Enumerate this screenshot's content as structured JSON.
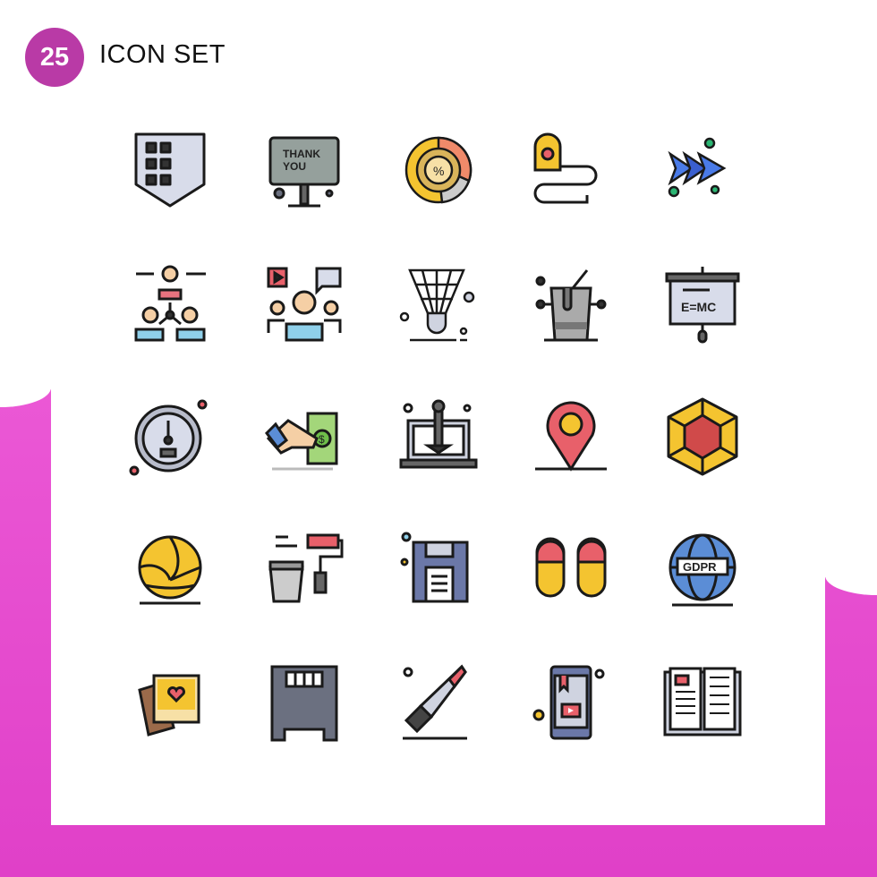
{
  "header": {
    "count": "25",
    "title": "ICON SET"
  },
  "colors": {
    "accent": "#b93aa6",
    "background_band": "#e94fd3",
    "stroke": "#1a1a1a"
  },
  "icons": [
    {
      "name": "shield-grid-icon"
    },
    {
      "name": "thank-you-billboard-icon",
      "text_line1": "THANK",
      "text_line2": "YOU"
    },
    {
      "name": "percent-donut-chart-icon",
      "text": "%"
    },
    {
      "name": "measuring-tape-icon"
    },
    {
      "name": "fast-forward-arrows-icon"
    },
    {
      "name": "team-hierarchy-icon"
    },
    {
      "name": "presenter-media-icon"
    },
    {
      "name": "shuttlecock-icon"
    },
    {
      "name": "ice-bucket-bottle-icon"
    },
    {
      "name": "emc-presentation-board-icon",
      "text": "E=MC"
    },
    {
      "name": "speedometer-gauge-icon"
    },
    {
      "name": "hand-payment-money-icon",
      "text": "$"
    },
    {
      "name": "laptop-joystick-icon"
    },
    {
      "name": "location-pin-icon"
    },
    {
      "name": "3d-cube-icon"
    },
    {
      "name": "volleyball-icon"
    },
    {
      "name": "paint-roller-bucket-icon"
    },
    {
      "name": "floppy-disk-icon"
    },
    {
      "name": "slippers-icon"
    },
    {
      "name": "gdpr-globe-icon",
      "text": "GDPR"
    },
    {
      "name": "love-photos-icon"
    },
    {
      "name": "sd-card-icon"
    },
    {
      "name": "bloody-knife-icon"
    },
    {
      "name": "mobile-video-book-icon"
    },
    {
      "name": "open-book-icon"
    }
  ]
}
